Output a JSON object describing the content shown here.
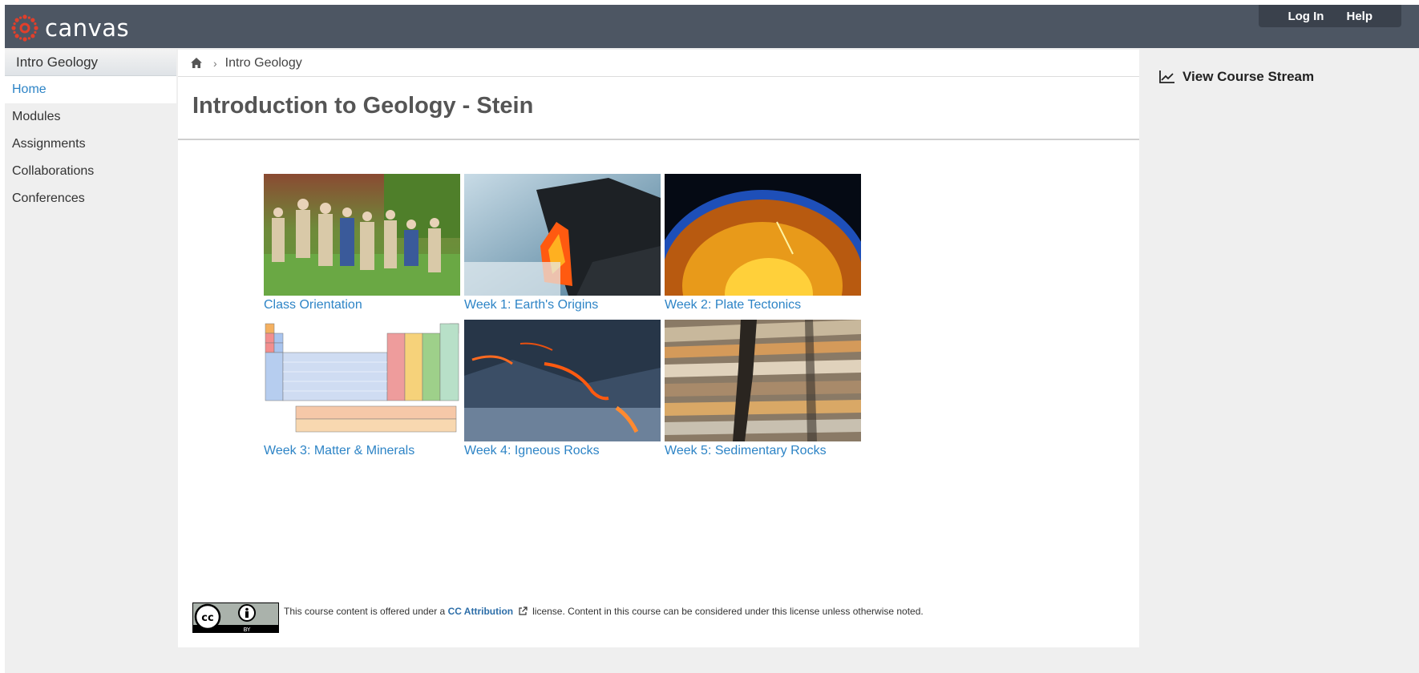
{
  "header": {
    "brand": "canvas",
    "login_label": "Log In",
    "help_label": "Help",
    "colors": {
      "bar": "#4d5663",
      "logo": "#e13f2b"
    }
  },
  "sidebar": {
    "course_title": "Intro Geology",
    "items": [
      {
        "label": "Home",
        "active": true
      },
      {
        "label": "Modules"
      },
      {
        "label": "Assignments"
      },
      {
        "label": "Collaborations"
      },
      {
        "label": "Conferences"
      }
    ]
  },
  "breadcrumb": {
    "icon": "home-icon",
    "current": "Intro Geology"
  },
  "main": {
    "title": "Introduction to Geology - Stein",
    "cards": [
      {
        "label": "Class Orientation",
        "image": "people-in-field"
      },
      {
        "label": "Week 1: Earth's Origins",
        "image": "lava-flow-ocean"
      },
      {
        "label": "Week 2: Plate Tectonics",
        "image": "earth-cross-section"
      },
      {
        "label": "Week 3: Matter & Minerals",
        "image": "periodic-table"
      },
      {
        "label": "Week 4: Igneous Rocks",
        "image": "cooling-lava"
      },
      {
        "label": "Week 5: Sedimentary Rocks",
        "image": "layered-rock"
      }
    ],
    "link_color": "#2d84c6"
  },
  "license": {
    "text_before": "This course content is offered under a",
    "link": "CC Attribution",
    "text_after": "license. Content in this course can be considered under this license unless otherwise noted.",
    "badge_label": "BY"
  },
  "right_sidebar": {
    "stream_label": "View Course Stream"
  }
}
